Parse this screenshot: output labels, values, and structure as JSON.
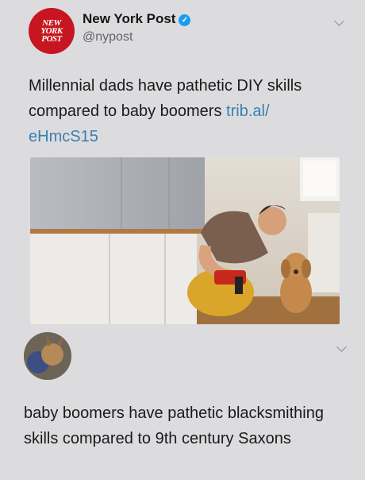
{
  "tweet": {
    "account_name": "New York Post",
    "handle": "@nypost",
    "logo_lines": [
      "NEW",
      "YORK",
      "POST"
    ],
    "text": "Millennial dads have pathetic DIY skills compared to baby boomers ",
    "link_part1": "trib.al/",
    "link_part2": "eHmcS15",
    "verified_icon": "verified-badge-icon",
    "brand_color": "#c7161f",
    "link_color": "#3a7fb0"
  },
  "reply": {
    "text": "baby boomers have pathetic blacksmithing skills compared to 9th century Saxons"
  }
}
